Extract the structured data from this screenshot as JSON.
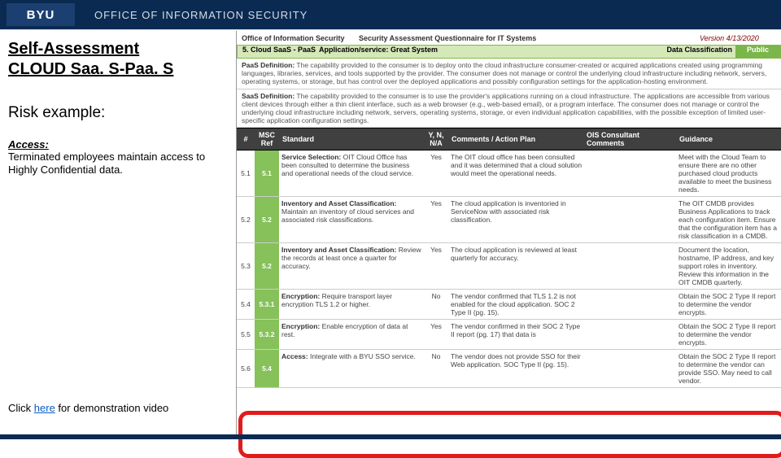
{
  "header": {
    "logo": "BYU",
    "office": "OFFICE OF INFORMATION SECURITY"
  },
  "left": {
    "title_l1": "Self-Assessment",
    "title_l2": "CLOUD Saa. S-Paa. S",
    "risk": "Risk example:",
    "access_label": "Access:",
    "access_text": "Terminated employees maintain access to Highly Confidential data.",
    "demo_pre": "Click ",
    "demo_link": "here",
    "demo_post": " for demonstration video"
  },
  "meta": {
    "office": "Office of Information Security",
    "doc": "Security Assessment Questionnaire for IT Systems",
    "version": "Version 4/13/2020"
  },
  "section": {
    "label": "5. Cloud SaaS - PaaS",
    "app": "Application/service: Great System",
    "dc_label": "Data Classification",
    "dc_value": "Public"
  },
  "defs": {
    "paas_title": "PaaS Definition:",
    "paas_text": " The capability provided to the consumer is to deploy onto the cloud infrastructure consumer-created or acquired applications created using programming languages, libraries, services, and tools supported by the provider. The consumer does not manage or control the underlying cloud infrastructure including network, servers, operating systems, or storage, but has control over the deployed applications and possibly configuration settings for the application-hosting environment.",
    "saas_title": "SaaS Definition:",
    "saas_text": " The capability provided to the consumer is to use the provider's applications running on a cloud infrastructure. The applications are accessible from various client devices through either a thin client interface, such as a web browser (e.g., web-based email), or a program interface. The consumer does not manage or control the underlying cloud infrastructure including network, servers, operating systems, storage, or even individual application capabilities, with the possible exception of limited user-specific application configuration settings."
  },
  "thead": {
    "num": "#",
    "msc": "MSC Ref",
    "std": "Standard",
    "yn": "Y, N, N/A",
    "cmt": "Comments / Action Plan",
    "ois": "OIS Consultant Comments",
    "gd": "Guidance"
  },
  "rows": [
    {
      "num": "5.1",
      "msc": "5.1",
      "std_b": "Service Selection:",
      "std": " OIT Cloud Office has been consulted to determine the business and operational needs of the cloud service.",
      "yn": "Yes",
      "cmt": "The OIT cloud office has been consulted and it was determined that a cloud solution would meet the operational needs.",
      "gd": "Meet with the Cloud Team to ensure there are no other purchased cloud products available to meet the business needs."
    },
    {
      "num": "5.2",
      "msc": "5.2",
      "std_b": "Inventory and Asset Classification:",
      "std": " Maintain an inventory of cloud services and associated risk classifications.",
      "yn": "Yes",
      "cmt": "The cloud application is inventoried in ServiceNow with associated risk classification.",
      "gd": "The OIT CMDB provides Business Applications to track each configuration item. Ensure that the configuration item has a risk classification in a CMDB."
    },
    {
      "num": "5.3",
      "msc": "5.2",
      "std_b": "Inventory and Asset Classification:",
      "std": " Review the records at least once a quarter for accuracy.",
      "yn": "Yes",
      "cmt": "The cloud application is reviewed at least quarterly for accuracy.",
      "gd": "Document the location, hostname, IP address, and key support roles in inventory. Review this information in the OIT CMDB quarterly."
    },
    {
      "num": "5.4",
      "msc": "5.3.1",
      "std_b": "Encryption:",
      "std": " Require transport layer encryption TLS 1.2 or higher.",
      "yn": "No",
      "cmt": "The vendor confirmed that TLS 1.2 is not enabled for the cloud application. SOC 2 Type II (pg. 15).",
      "gd": "Obtain the SOC 2 Type II report to determine the vendor encrypts."
    },
    {
      "num": "5.5",
      "msc": "5.3.2",
      "std_b": "Encryption:",
      "std": " Enable encryption of data at rest.",
      "yn": "Yes",
      "cmt": "The vendor confirmed in their SOC 2 Type II report (pg. 17) that data is",
      "gd": "Obtain the SOC 2 Type II report to determine the vendor encrypts."
    },
    {
      "num": "5.6",
      "msc": "5.4",
      "std_b": "Access:",
      "std": " Integrate with a BYU SSO service.",
      "yn": "No",
      "cmt": "The vendor does not provide SSO for their Web application. SOC Type II (pg. 15).",
      "gd": "Obtain the SOC 2 Type II report to determine the vendor can provide SSO. May need to call vendor."
    }
  ]
}
